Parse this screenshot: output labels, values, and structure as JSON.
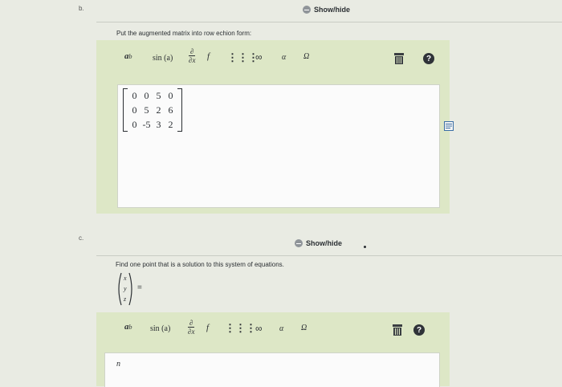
{
  "parts": {
    "b": {
      "label": "b.",
      "showhide": "Show/hide",
      "prompt": "Put the augmented matrix into row echion form:",
      "matrix": [
        [
          "0",
          "0",
          "5",
          "0"
        ],
        [
          "0",
          "5",
          "2",
          "6"
        ],
        [
          "0",
          "-5",
          "3",
          "2"
        ]
      ]
    },
    "c": {
      "label": "c.",
      "showhide": "Show/hide",
      "prompt": "Find one point that is a solution to this system of equations.",
      "vector_vars": [
        "x",
        "y",
        "z"
      ],
      "equals": "=",
      "input_value": "n"
    }
  },
  "toolbar": {
    "power": "a",
    "power_sup": "b",
    "sin": "sin (a)",
    "partial_top": "∂",
    "partial_bottom": "∂x",
    "partial_f": "f",
    "grid": "⋮⋮⋮",
    "infinity": "∞",
    "alpha": "α",
    "omega": "Ω",
    "help": "?"
  },
  "colors": {
    "panel": "#dde7c6",
    "input": "#fbfbfb",
    "background": "#e9ebe3"
  }
}
